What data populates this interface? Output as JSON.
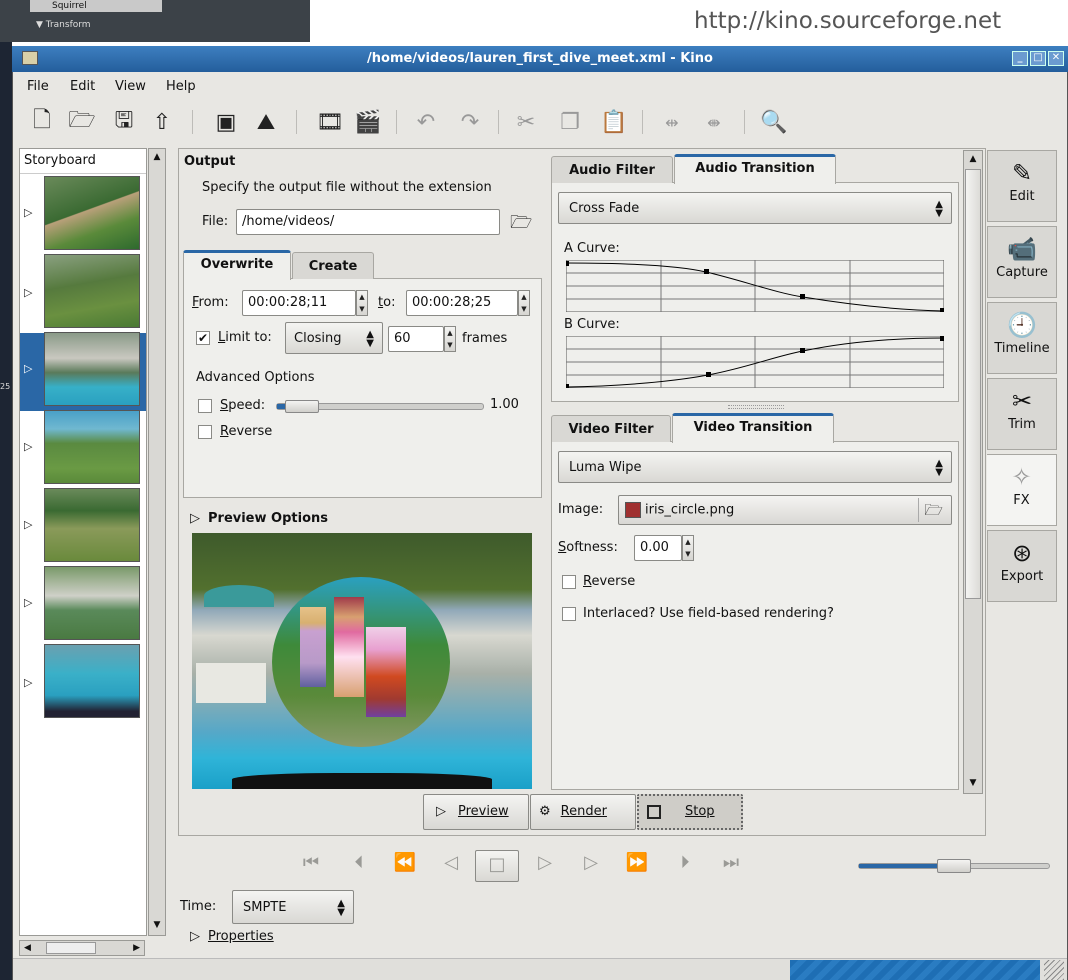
{
  "watermark_url": "http://kino.sourceforge.net",
  "background_app": {
    "items": [
      "Squirrel",
      "Transform"
    ],
    "ruler_label": "25"
  },
  "window": {
    "title": "/home/videos/lauren_first_dive_meet.xml - Kino"
  },
  "menu": [
    "File",
    "Edit",
    "View",
    "Help"
  ],
  "storyboard": {
    "title": "Storyboard",
    "thumb_count": 7
  },
  "output": {
    "heading": "Output",
    "instruction": "Specify the output file without the extension",
    "file_label": "File:",
    "file_value": "/home/videos/"
  },
  "tabs_mode": [
    "Overwrite",
    "Create"
  ],
  "range": {
    "from_label": "From:",
    "from_value": "00:00:28;11",
    "to_label": "to:",
    "to_value": "00:00:28;25"
  },
  "limit": {
    "label": "Limit to:",
    "checked": true,
    "mode": "Closing",
    "count": "60",
    "unit": "frames"
  },
  "advanced": {
    "heading": "Advanced Options",
    "speed_label": "Speed:",
    "speed_value": "1.00",
    "reverse_label": "Reverse"
  },
  "preview_options": {
    "label": "Preview Options"
  },
  "audio_tabs": [
    "Audio Filter",
    "Audio Transition"
  ],
  "audio_transition": {
    "selected": "Cross Fade",
    "a_curve_label": "A Curve:",
    "b_curve_label": "B Curve:"
  },
  "video_tabs": [
    "Video Filter",
    "Video Transition"
  ],
  "video_transition": {
    "selected": "Luma Wipe",
    "image_label": "Image:",
    "image_value": "iris_circle.png",
    "softness_label": "Softness:",
    "softness_value": "0.00",
    "reverse_label": "Reverse",
    "interlaced_label": "Interlaced? Use field-based rendering?"
  },
  "actions": {
    "preview": "Preview",
    "render": "Render",
    "stop": "Stop"
  },
  "side_tabs": [
    {
      "label": "Edit",
      "icon": "edit-icon"
    },
    {
      "label": "Capture",
      "icon": "camera-icon"
    },
    {
      "label": "Timeline",
      "icon": "clock-icon"
    },
    {
      "label": "Trim",
      "icon": "trim-icon"
    },
    {
      "label": "FX",
      "icon": "sparkle-icon"
    },
    {
      "label": "Export",
      "icon": "film-reel-icon"
    }
  ],
  "time": {
    "label": "Time:",
    "format": "SMPTE"
  },
  "properties": {
    "label": "Properties"
  },
  "colors": {
    "accent": "#2a67a6",
    "titlebar": "#2b6cae",
    "status": "#1e6eb4"
  }
}
